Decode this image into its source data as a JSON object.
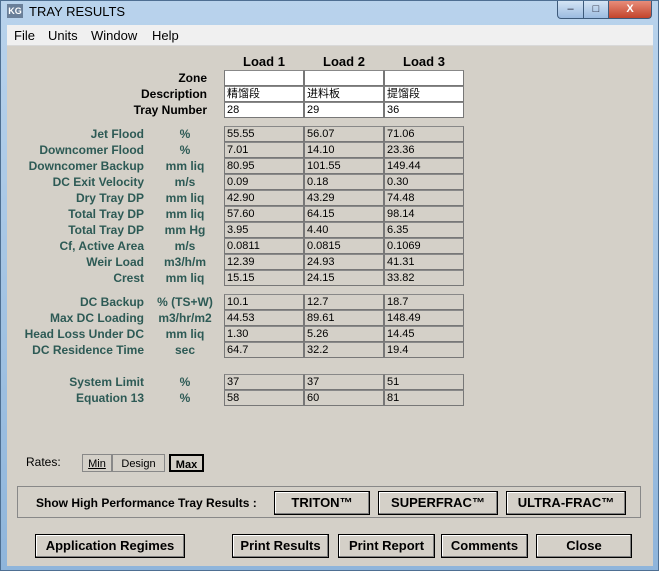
{
  "window": {
    "title": "TRAY RESULTS",
    "app_icon_text": "KG",
    "close_glyph": "X",
    "min_glyph": "–",
    "max_glyph": "□"
  },
  "menu": [
    "File",
    "Units",
    "Window",
    "Help"
  ],
  "columns": [
    "Load 1",
    "Load 2",
    "Load 3"
  ],
  "header_rows": [
    {
      "label": "Zone",
      "values": [
        "",
        "",
        ""
      ]
    },
    {
      "label": "Description",
      "values": [
        "精馏段",
        "进料板",
        "提馏段"
      ]
    },
    {
      "label": "Tray Number",
      "values": [
        "28",
        "29",
        "36"
      ]
    }
  ],
  "group1": [
    {
      "label": "Jet Flood",
      "unit": "%",
      "values": [
        "55.55",
        "56.07",
        "71.06"
      ]
    },
    {
      "label": "Downcomer Flood",
      "unit": "%",
      "values": [
        "7.01",
        "14.10",
        "23.36"
      ]
    },
    {
      "label": "Downcomer Backup",
      "unit": "mm liq",
      "values": [
        "80.95",
        "101.55",
        "149.44"
      ]
    },
    {
      "label": "DC Exit Velocity",
      "unit": "m/s",
      "values": [
        "0.09",
        "0.18",
        "0.30"
      ]
    },
    {
      "label": "Dry Tray DP",
      "unit": "mm liq",
      "values": [
        "42.90",
        "43.29",
        "74.48"
      ]
    },
    {
      "label": "Total Tray DP",
      "unit": "mm liq",
      "values": [
        "57.60",
        "64.15",
        "98.14"
      ]
    },
    {
      "label": "Total Tray DP",
      "unit": "mm Hg",
      "values": [
        "3.95",
        "4.40",
        "6.35"
      ]
    },
    {
      "label": "Cf, Active Area",
      "unit": "m/s",
      "values": [
        "0.0811",
        "0.0815",
        "0.1069"
      ]
    },
    {
      "label": "Weir Load",
      "unit": "m3/h/m",
      "values": [
        "12.39",
        "24.93",
        "41.31"
      ]
    },
    {
      "label": "Crest",
      "unit": "mm liq",
      "values": [
        "15.15",
        "24.15",
        "33.82"
      ]
    }
  ],
  "group2": [
    {
      "label": "DC Backup",
      "unit": "% (TS+W)",
      "values": [
        "10.1",
        "12.7",
        "18.7"
      ]
    },
    {
      "label": "Max DC Loading",
      "unit": "m3/hr/m2",
      "values": [
        "44.53",
        "89.61",
        "148.49"
      ]
    },
    {
      "label": "Head Loss Under DC",
      "unit": "mm liq",
      "values": [
        "1.30",
        "5.26",
        "14.45"
      ]
    },
    {
      "label": "DC Residence Time",
      "unit": "sec",
      "values": [
        "64.7",
        "32.2",
        "19.4"
      ]
    }
  ],
  "group3": [
    {
      "label": "System Limit",
      "unit": "%",
      "values": [
        "37",
        "37",
        "51"
      ]
    },
    {
      "label": "Equation 13",
      "unit": "%",
      "values": [
        "58",
        "60",
        "81"
      ]
    }
  ],
  "rates": {
    "label": "Rates:",
    "options": [
      "Min",
      "Design",
      "Max"
    ],
    "selected": "Max"
  },
  "high_performance": {
    "label": "Show High Performance Tray Results :",
    "buttons": [
      "TRITON™",
      "SUPERFRAC™",
      "ULTRA-FRAC™"
    ]
  },
  "footer_buttons": [
    "Application Regimes",
    "Print Results",
    "Print Report",
    "Comments",
    "Close"
  ]
}
